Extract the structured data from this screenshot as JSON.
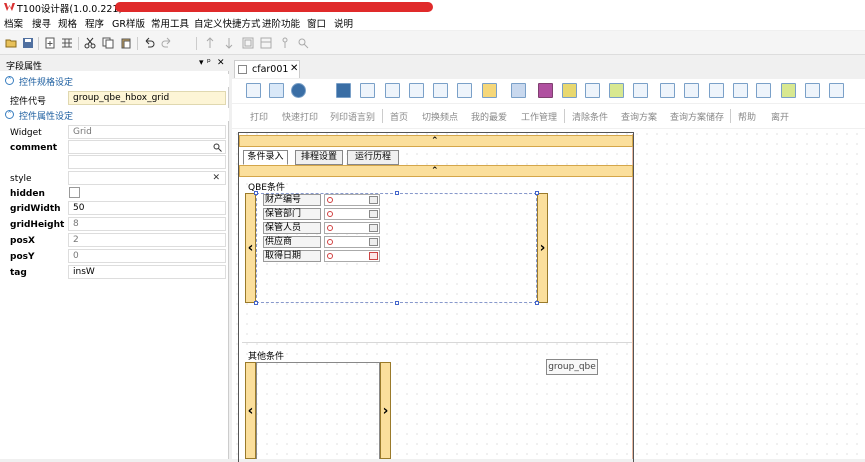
{
  "window": {
    "title": "T100设计器(1.0.0.221)"
  },
  "menu": {
    "items": [
      "档案",
      "搜寻",
      "规格",
      "程序",
      "GR样版",
      "常用工具",
      "自定义快捷方式",
      "进阶功能",
      "窗口",
      "说明"
    ]
  },
  "left_panel": {
    "title": "字段属性",
    "controls": [
      "▾",
      "ᵖ",
      "✕"
    ],
    "section1": "控件规格设定",
    "control_code_label": "控件代号",
    "control_code_value": "group_qbe_hbox_grid",
    "section2": "控件属性设定",
    "props": [
      {
        "name": "Widget",
        "value": "Grid",
        "bold": false
      },
      {
        "name": "comment",
        "value": "",
        "bold": true
      },
      {
        "name": "style",
        "value": "",
        "bold": false
      },
      {
        "name": "hidden",
        "value": "",
        "bold": true
      },
      {
        "name": "gridWidth",
        "value": "50",
        "bold": true
      },
      {
        "name": "gridHeight",
        "value": "8",
        "bold": true
      },
      {
        "name": "posX",
        "value": "2",
        "bold": true
      },
      {
        "name": "posY",
        "value": "0",
        "bold": true
      },
      {
        "name": "tag",
        "value": "insW",
        "bold": true
      }
    ],
    "search_icon": "search-icon",
    "clear_icon": "✕"
  },
  "editor": {
    "tab_label": "cfar001",
    "tab_close": "✕",
    "action_buttons": [
      "打印",
      "快速打印",
      "列印语言别",
      "首页",
      "切换频点",
      "我的最爱",
      "工作管理",
      "清除条件",
      "查询方案",
      "查询方案储存",
      "帮助",
      "离开"
    ],
    "form_tabs": [
      "条件录入",
      "排程设置",
      "运行历程"
    ],
    "qbe_title": "QBE条件",
    "qbe_fields": [
      "财产编号",
      "保管部门",
      "保管人员",
      "供应商",
      "取得日期"
    ],
    "other_title": "其他条件",
    "group_label": "group_qbe",
    "chevron_up": "⌃"
  }
}
